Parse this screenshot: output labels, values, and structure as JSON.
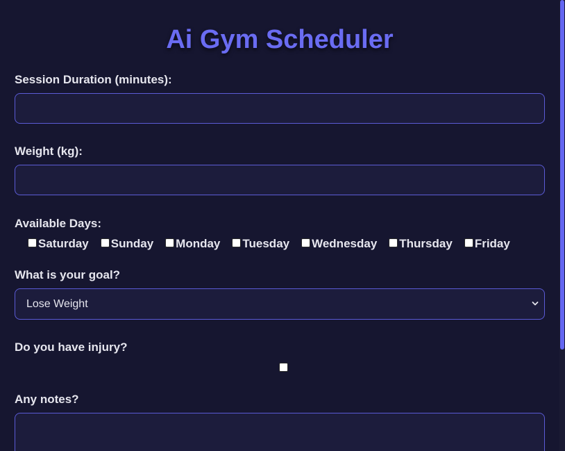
{
  "app": {
    "title": "Ai Gym Scheduler"
  },
  "form": {
    "session_duration": {
      "label": "Session Duration (minutes):",
      "value": ""
    },
    "weight": {
      "label": "Weight (kg):",
      "value": ""
    },
    "available_days": {
      "label": "Available Days:",
      "days": [
        {
          "label": "Saturday",
          "checked": false
        },
        {
          "label": "Sunday",
          "checked": false
        },
        {
          "label": "Monday",
          "checked": false
        },
        {
          "label": "Tuesday",
          "checked": false
        },
        {
          "label": "Wednesday",
          "checked": false
        },
        {
          "label": "Thursday",
          "checked": false
        },
        {
          "label": "Friday",
          "checked": false
        }
      ]
    },
    "goal": {
      "label": "What is your goal?",
      "selected": "Lose Weight"
    },
    "injury": {
      "label": "Do you have injury?",
      "checked": false
    },
    "notes": {
      "label": "Any notes?",
      "value": ""
    }
  },
  "theme": {
    "accent": "#6366f1",
    "title_color": "#6a6cf2",
    "background": "#14142a",
    "field_background": "#1c1c3c",
    "field_border": "#5b5bd6",
    "text": "#e6e6ee"
  },
  "icons": {
    "select_arrow": "chevron-down-icon"
  }
}
